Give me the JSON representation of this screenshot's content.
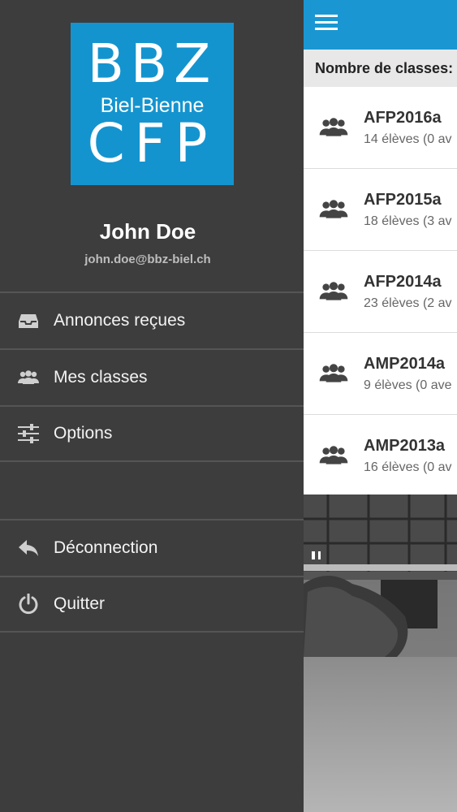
{
  "drawer": {
    "logo": {
      "line1": "BBZ",
      "line2": "Biel-Bienne",
      "line3": "CFP"
    },
    "user": {
      "name": "John Doe",
      "email": "john.doe@bbz-biel.ch"
    },
    "menu_top": [
      {
        "label": "Annonces reçues",
        "icon": "inbox-icon"
      },
      {
        "label": "Mes classes",
        "icon": "group-icon"
      },
      {
        "label": "Options",
        "icon": "sliders-icon"
      }
    ],
    "menu_bottom": [
      {
        "label": "Déconnection",
        "icon": "reply-icon"
      },
      {
        "label": "Quitter",
        "icon": "power-icon"
      }
    ]
  },
  "content": {
    "count_label": "Nombre de classes:",
    "classes": [
      {
        "name": "AFP2016a",
        "students": "14 élèves (0 av"
      },
      {
        "name": "AFP2015a",
        "students": "18 élèves (3 av"
      },
      {
        "name": "AFP2014a",
        "students": "23 élèves (2 av"
      },
      {
        "name": "AMP2014a",
        "students": "9 élèves (0 ave"
      },
      {
        "name": "AMP2013a",
        "students": "16 élèves (0 av"
      }
    ]
  },
  "colors": {
    "drawer_bg": "#3d3d3d",
    "accent": "#1a97d2",
    "logo_bg": "#1494cf"
  }
}
